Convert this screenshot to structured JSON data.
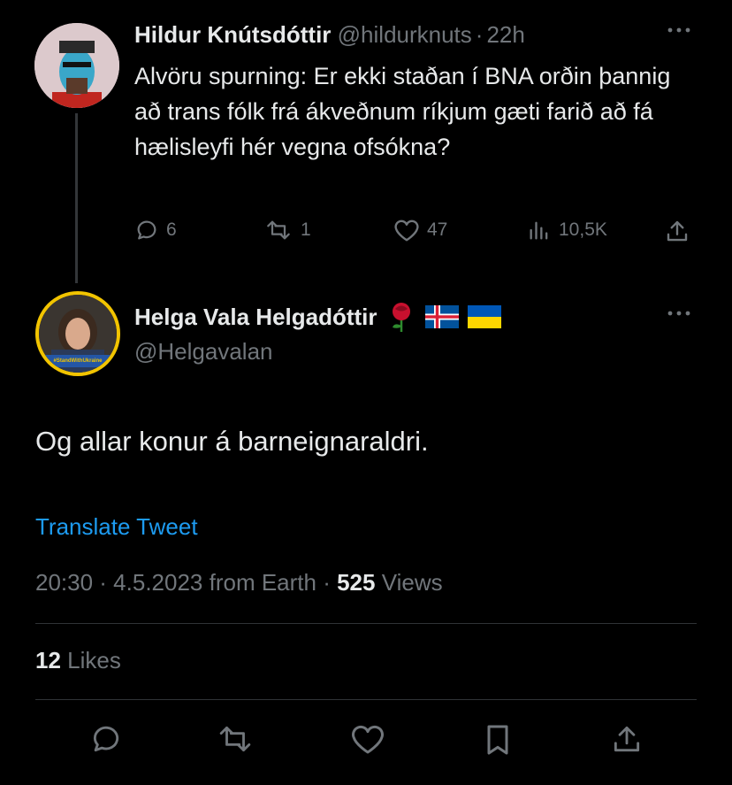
{
  "reply_tweet": {
    "author_name": "Hildur Knútsdóttir",
    "handle": "@hildurknuts",
    "separator": "·",
    "time": "22h",
    "text": "Alvöru spurning: Er ekki staðan í BNA orðin þannig að trans fólk frá ákveðnum ríkjum gæti farið að fá hælisleyfi hér vegna ofsókna?",
    "stats": {
      "replies": "6",
      "retweets": "1",
      "likes": "47",
      "views": "10,5K"
    }
  },
  "main_tweet": {
    "author_name": "Helga Vala Helgadóttir",
    "handle": "@Helgavalan",
    "avatar_badge": "#StandWithUkraine",
    "text": "Og allar konur á barneignaraldri.",
    "translate_label": "Translate Tweet",
    "timestamp": "20:30 · 4.5.2023 from Earth ·",
    "views_count": "525",
    "views_label": "Views",
    "likes_count": "12",
    "likes_label": "Likes"
  },
  "colors": {
    "background": "#000000",
    "text": "#e7e9ea",
    "muted": "#71767b",
    "link": "#1d9bf0",
    "divider": "#2f3336"
  },
  "icons": [
    "reply-icon",
    "retweet-icon",
    "like-icon",
    "views-icon",
    "share-icon",
    "bookmark-icon",
    "more-icon",
    "rose-emoji",
    "iceland-flag",
    "ukraine-flag"
  ]
}
